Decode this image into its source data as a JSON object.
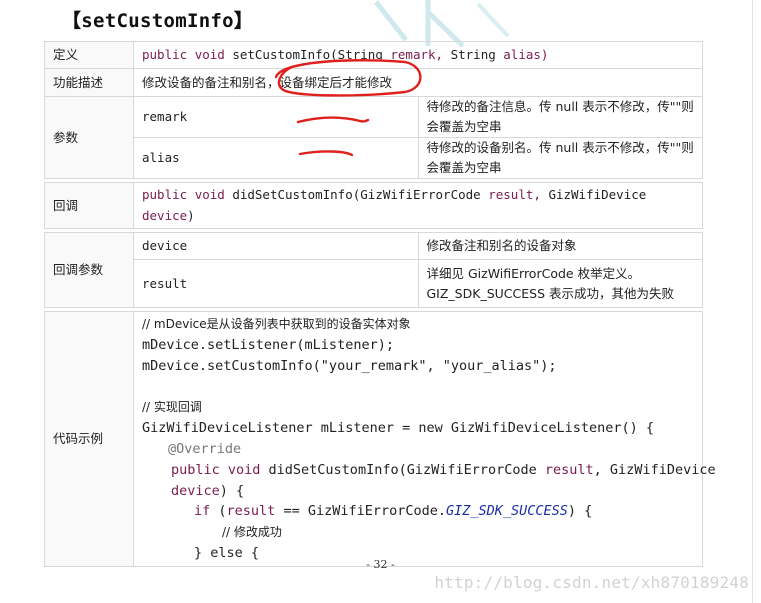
{
  "title": "【setCustomInfo】",
  "rows": {
    "definition": {
      "label": "定义",
      "kw_public": "public",
      "kw_void": "void",
      "method": "setCustomInfo(String",
      "param1": "remark,",
      "type2": "String",
      "param2": "alias)"
    },
    "description": {
      "label": "功能描述",
      "text": "修改设备的备注和别名，设备绑定后才能修改"
    },
    "params": {
      "label": "参数",
      "items": [
        {
          "name": "remark",
          "desc": "待修改的备注信息。传 null 表示不修改，传\"\"则会覆盖为空串"
        },
        {
          "name": "alias",
          "desc": "待修改的设备别名。传 null 表示不修改，传\"\"则会覆盖为空串"
        }
      ]
    },
    "callback": {
      "label": "回调",
      "kw_public": "public",
      "kw_void": "void",
      "method": "didSetCustomInfo(GizWifiErrorCode",
      "param1": "result,",
      "type2": "GizWifiDevice",
      "param2": "device",
      "close": ")"
    },
    "callback_params": {
      "label": "回调参数",
      "items": [
        {
          "name": "device",
          "desc": "修改备注和别名的设备对象"
        },
        {
          "name": "result",
          "desc": "详细见 GizWifiErrorCode 枚举定义。GIZ_SDK_SUCCESS 表示成功，其他为失败"
        }
      ]
    },
    "example": {
      "label": "代码示例",
      "l1": "// mDevice是从设备列表中获取到的设备实体对象",
      "l2": "mDevice.setListener(mListener);",
      "l3": "mDevice.setCustomInfo(\"your_remark\", \"your_alias\");",
      "l5": "// 实现回调",
      "l6": "GizWifiDeviceListener mListener = new GizWifiDeviceListener() {",
      "l7": "@Override",
      "l8_kw": "public void",
      "l8_rest": " didSetCustomInfo(GizWifiErrorCode ",
      "l8_param": "result",
      "l8_tail": ", GizWifiDevice",
      "l9_param": "device",
      "l9_tail": ") {",
      "l10_kw": "if",
      "l10_a": " (",
      "l10_param": "result",
      "l10_b": " == GizWifiErrorCode.",
      "l10_const": "GIZ_SDK_SUCCESS",
      "l10_c": ") {",
      "l11": "// 修改成功",
      "l12": "} else {"
    }
  },
  "page_number": "- 32 -",
  "watermark": "http://blog.csdn.net/xh870189248",
  "colors": {
    "keyword": "#7b1c4f",
    "constant": "#1a2fa6",
    "annotation": "#777777",
    "pen_mark": "#e0201c",
    "border": "#d8d8d8"
  }
}
